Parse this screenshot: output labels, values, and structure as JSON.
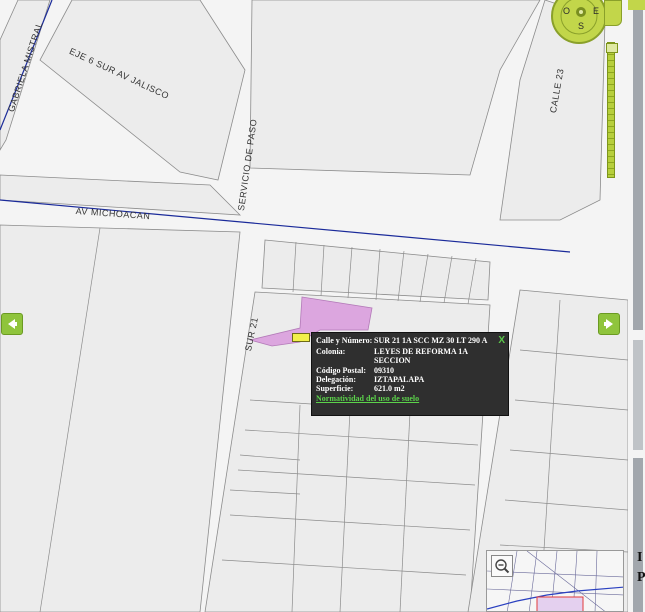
{
  "streets": {
    "gabriela_mistral": "GABRIELA MISTRAL",
    "eje6_sur": "EJE 6 SUR AV JALISCO",
    "servicio_de_paso": "SERVICIO DE PASO",
    "calle_23": "CALLE 23",
    "av_michoacan": "AV MICHOACAN",
    "sur_21": "SUR 21"
  },
  "compass": {
    "west": "O",
    "east": "E",
    "south": "S"
  },
  "popup": {
    "rows": [
      {
        "label": "Calle y Número:",
        "value": "SUR 21 1A SCC MZ 30 LT 290 A"
      },
      {
        "label": "Colonia:",
        "value": "LEYES DE REFORMA 1A SECCION"
      },
      {
        "label": "Código Postal:",
        "value": "09310"
      },
      {
        "label": "Delegación:",
        "value": "IZTAPALAPA"
      },
      {
        "label": "Superficie:",
        "value": "621.0 m2"
      }
    ],
    "close_label": "X",
    "link_label": "Normatividad del uso de suelo"
  },
  "side_text": {
    "line1": "I",
    "line2": "P"
  },
  "icons": {
    "left_nav": "arrow-left-icon",
    "right_nav": "arrow-right-icon",
    "overview_zoom": "magnifier-minus-icon"
  },
  "colors": {
    "parcel": "#dca6df",
    "nav_arrow": "#8fc43c",
    "compass": "#c2d64a",
    "avenue_line": "#1a2a9a",
    "popup_bg": "#2f2f2f",
    "link": "#5bd24a"
  }
}
